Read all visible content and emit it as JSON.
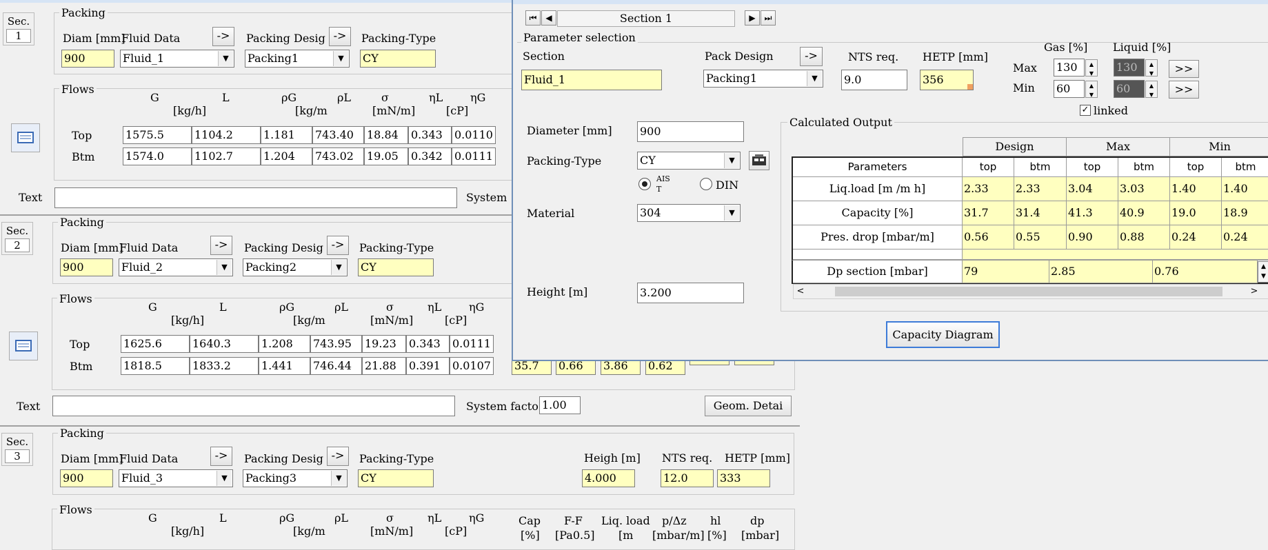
{
  "headers": {
    "diam": "Diam [mm]",
    "fluid": "Fluid Data",
    "packdes": "Packing Desig",
    "packtype": "Packing-Type",
    "heigh": "Heigh [m]",
    "nts": "NTS req.",
    "hetp": "HETP [mm]",
    "packing": "Packing",
    "flows": "Flows",
    "text": "Text",
    "system": "System",
    "system_factor": "System facto",
    "geom": "Geom. Detai",
    "arrow": "->",
    "sec": "Sec.",
    "cols": {
      "g": "G",
      "l": "L",
      "rg": "ρG",
      "rl": "ρL",
      "sig": "σ",
      "el": "ηL",
      "eg": "ηG",
      "kgh": "[kg/h]",
      "kgm": "[kg/m",
      "mnm": "[mN/m]",
      "cp": "[cP]"
    },
    "top": "Top",
    "btm": "Btm",
    "extra": {
      "cap": "Cap",
      "ff": "F-F",
      "liq": "Liq. load",
      "dpdz": "p/Δz",
      "hl": "hl",
      "dp": "dp",
      "cap_u": "[%]",
      "ff_u": "[Pa0.5]",
      "liq_u": "[m",
      "dpdz_u": "[mbar/m]",
      "hl_u": "[%]",
      "dp_u": "[mbar]"
    }
  },
  "sections": [
    {
      "no": "1",
      "diam": "900",
      "fluid": "Fluid_1",
      "packing": "Packing1",
      "type": "CY",
      "top": [
        "1575.5",
        "1104.2",
        "1.181",
        "743.40",
        "18.84",
        "0.343",
        "0.0110"
      ],
      "btm": [
        "1574.0",
        "1102.7",
        "1.204",
        "743.02",
        "19.05",
        "0.342",
        "0.0111"
      ]
    },
    {
      "no": "2",
      "diam": "900",
      "fluid": "Fluid_2",
      "packing": "Packing2",
      "type": "CY",
      "top": [
        "1625.6",
        "1640.3",
        "1.208",
        "743.95",
        "19.23",
        "0.343",
        "0.0111"
      ],
      "btm": [
        "1818.5",
        "1833.2",
        "1.441",
        "746.44",
        "21.88",
        "0.391",
        "0.0107"
      ],
      "system_factor": "1.00",
      "partial": [
        "35.7",
        "0.66",
        "3.86",
        "0.62"
      ]
    },
    {
      "no": "3",
      "diam": "900",
      "fluid": "Fluid_3",
      "packing": "Packing3",
      "type": "CY",
      "height": "4.000",
      "nts": "12.0",
      "hetp": "333"
    }
  ],
  "dialog": {
    "nav_title": "Section 1",
    "nav_first": "⏮",
    "nav_prev": "◀",
    "nav_next": "▶",
    "nav_last": "⏭",
    "param_sel": "Parameter selection",
    "section_lbl": "Section",
    "section_val": "Fluid_1",
    "packdesign_lbl": "Pack Design",
    "packdesign_val": "Packing1",
    "nts_lbl": "NTS req.",
    "nts_val": "9.0",
    "hetp_lbl": "HETP [mm]",
    "hetp_val": "356",
    "gas_lbl": "Gas [%]",
    "liquid_lbl": "Liquid [%]",
    "max_lbl": "Max",
    "min_lbl": "Min",
    "gas_max": "130",
    "gas_min": "60",
    "liq_max": "130",
    "liq_min": "60",
    "more": ">>",
    "linked": "linked",
    "diameter_lbl": "Diameter [mm]",
    "diameter_val": "900",
    "packtype_lbl": "Packing-Type",
    "packtype_val": "CY",
    "radio_aist": "AIS T",
    "radio_din": "DIN",
    "material_lbl": "Material",
    "material_val": "304",
    "height_lbl": "Height [m]",
    "height_val": "3.200",
    "calc_out": "Calculated Output",
    "design": "Design",
    "max": "Max",
    "min": "Min",
    "parameters": "Parameters",
    "top": "top",
    "btm": "btm",
    "rows": [
      {
        "label": "Liq.load [m /m h]",
        "values": [
          "2.33",
          "2.33",
          "3.04",
          "3.03",
          "1.40",
          "1.40"
        ]
      },
      {
        "label": "Capacity [%]",
        "values": [
          "31.7",
          "31.4",
          "41.3",
          "40.9",
          "19.0",
          "18.9"
        ]
      },
      {
        "label": "Pres. drop [mbar/m]",
        "values": [
          "0.56",
          "0.55",
          "0.90",
          "0.88",
          "0.24",
          "0.24"
        ]
      }
    ],
    "dp_label": "Dp section [mbar]",
    "dp_values": [
      "79",
      "2.85",
      "0.76"
    ],
    "cap_diagram": "Capacity Diagram"
  }
}
